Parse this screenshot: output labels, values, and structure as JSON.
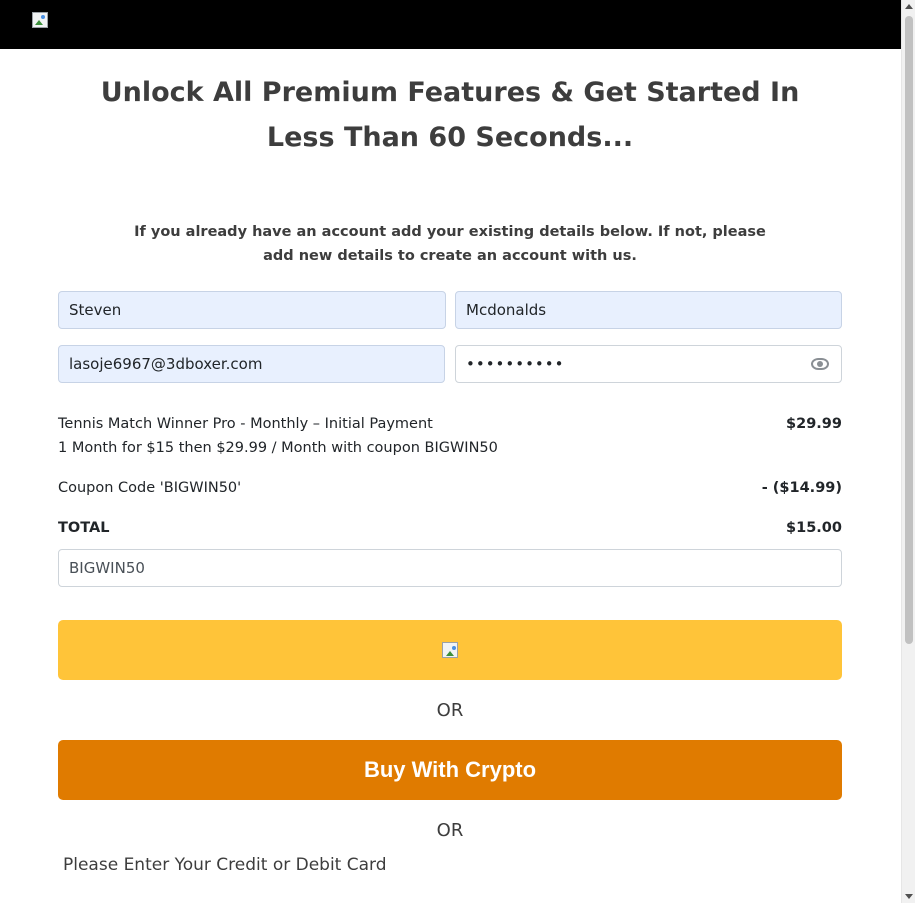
{
  "header": {
    "logo_icon": "broken-image-icon"
  },
  "headline": "Unlock All Premium Features & Get Started In Less Than 60 Seconds...",
  "intro": "If you already have an account add your existing details below. If not, please add new details to create an account with us.",
  "form": {
    "first_name": "Steven",
    "last_name": "Mcdonalds",
    "email": "lasoje6967@3dboxer.com",
    "password_masked": "••••••••••"
  },
  "order": {
    "product": "Tennis Match Winner Pro - Monthly – Initial Payment",
    "product_price": "$29.99",
    "product_desc": "1 Month for $15 then $29.99 / Month with coupon BIGWIN50",
    "coupon_label": "Coupon Code 'BIGWIN50'",
    "coupon_amount": "- ($14.99)",
    "total_label": "TOTAL",
    "total_amount": "$15.00"
  },
  "coupon_input": "BIGWIN50",
  "or_text": "OR",
  "crypto_button": "Buy With Crypto",
  "card_label": "Please Enter Your Credit or Debit Card",
  "colors": {
    "paypal_yellow": "#ffc439",
    "crypto_orange": "#e07b00",
    "autofill_blue": "#e8f0fe"
  }
}
